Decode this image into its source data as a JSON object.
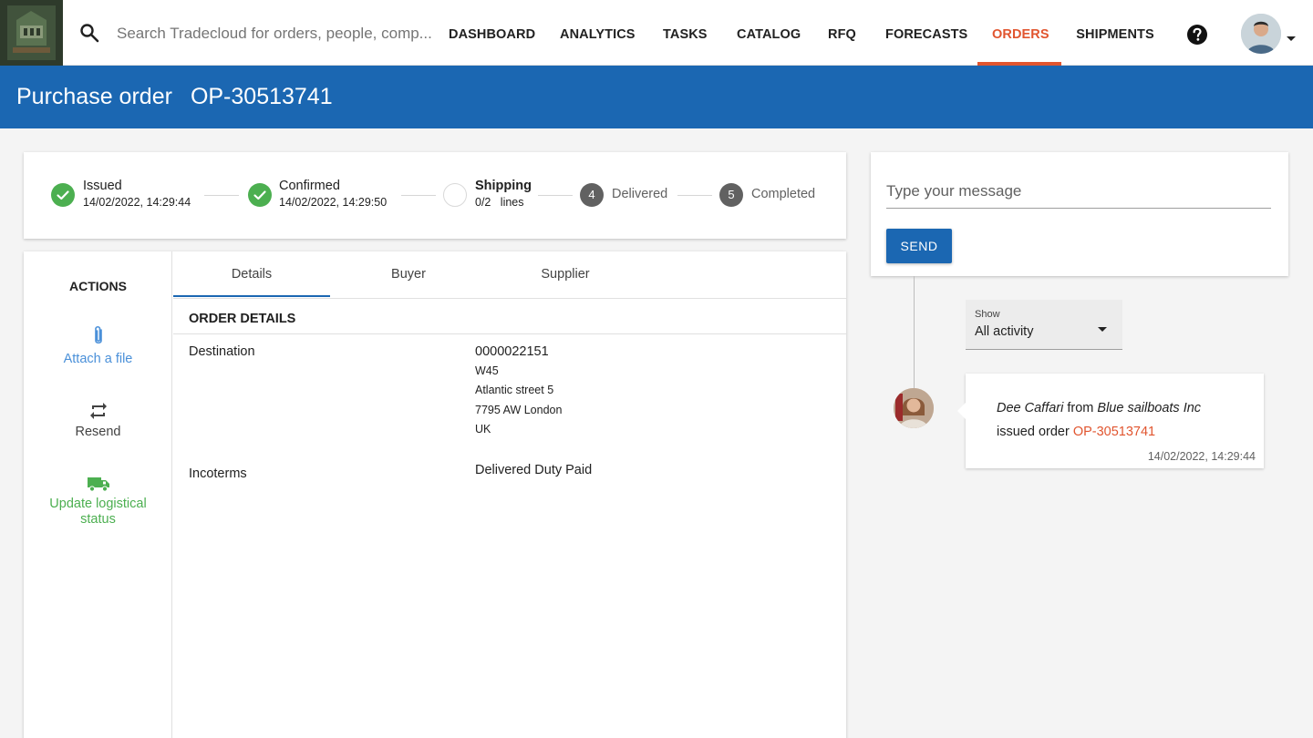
{
  "header": {
    "search_placeholder": "Search Tradecloud for orders, people, comp...",
    "nav": [
      {
        "label": "DASHBOARD",
        "active": false
      },
      {
        "label": "ANALYTICS",
        "active": false
      },
      {
        "label": "TASKS",
        "active": false
      },
      {
        "label": "CATALOG",
        "active": false
      },
      {
        "label": "RFQ",
        "active": false
      },
      {
        "label": "FORECASTS",
        "active": false
      },
      {
        "label": "ORDERS",
        "active": true
      },
      {
        "label": "SHIPMENTS",
        "active": false
      }
    ],
    "icons": [
      "logo",
      "search-icon",
      "help-icon",
      "user-avatar",
      "caret-down-icon"
    ]
  },
  "page": {
    "title": "Purchase order",
    "order_number": "OP-30513741"
  },
  "progress": {
    "steps": [
      {
        "title": "Issued",
        "subtitle": "14/02/2022, 14:29:44",
        "state": "done"
      },
      {
        "title": "Confirmed",
        "subtitle": "14/02/2022, 14:29:50",
        "state": "done"
      },
      {
        "title": "Shipping",
        "subtitle": "0/2   lines",
        "state": "current"
      },
      {
        "title": "Delivered",
        "number": "4",
        "state": "todo"
      },
      {
        "title": "Completed",
        "number": "5",
        "state": "todo"
      }
    ]
  },
  "actions": {
    "title": "ACTIONS",
    "items": [
      {
        "label": "Attach a file",
        "icon": "paperclip-icon",
        "color": "#4a90d9"
      },
      {
        "label": "Resend",
        "icon": "repeat-icon",
        "color": "#424242"
      },
      {
        "label": "Update logistical status",
        "icon": "truck-icon",
        "color": "#4caf50"
      }
    ]
  },
  "tabs": [
    {
      "label": "Details",
      "active": true
    },
    {
      "label": "Buyer",
      "active": false
    },
    {
      "label": "Supplier",
      "active": false
    }
  ],
  "details": {
    "section_title": "ORDER DETAILS",
    "destination_label": "Destination",
    "destination_code": "0000022151",
    "address_lines": [
      "W45",
      "Atlantic street 5",
      "7795 AW London",
      "UK"
    ],
    "incoterms_label": "Incoterms",
    "incoterms_value": "Delivered Duty Paid"
  },
  "messages": {
    "placeholder": "Type your message",
    "send_label": "SEND"
  },
  "activity": {
    "filter_label": "Show",
    "filter_value": "All activity",
    "items": [
      {
        "person": "Dee Caffari",
        "from_word": "from",
        "company": "Blue sailboats Inc",
        "action_text": "issued order",
        "order_link": "OP-30513741",
        "timestamp": "14/02/2022, 14:29:44"
      }
    ]
  },
  "colors": {
    "brand_blue": "#1b67b2",
    "active_orange": "#e1552f",
    "success_green": "#4caf50",
    "link_blue": "#4a90d9"
  }
}
